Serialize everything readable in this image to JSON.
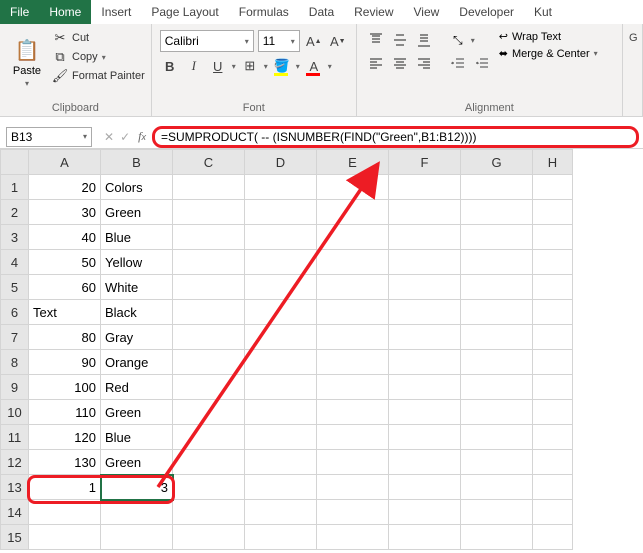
{
  "tabs": {
    "file": "File",
    "home": "Home",
    "insert": "Insert",
    "pageLayout": "Page Layout",
    "formulas": "Formulas",
    "data": "Data",
    "review": "Review",
    "view": "View",
    "developer": "Developer",
    "kutools": "Kut"
  },
  "ribbon": {
    "clipboard": {
      "paste": "Paste",
      "cut": "Cut",
      "copy": "Copy",
      "formatPainter": "Format Painter",
      "label": "Clipboard"
    },
    "font": {
      "name": "Calibri",
      "size": "11",
      "label": "Font"
    },
    "alignment": {
      "wrapText": "Wrap Text",
      "mergeCenter": "Merge & Center",
      "label": "Alignment"
    }
  },
  "nameBox": "B13",
  "formula": "=SUMPRODUCT( -- (ISNUMBER(FIND(\"Green\",B1:B12))))",
  "columns": [
    "A",
    "B",
    "C",
    "D",
    "E",
    "F",
    "G",
    "H"
  ],
  "rows": [
    {
      "n": "1",
      "a": "20",
      "b": "Colors"
    },
    {
      "n": "2",
      "a": "30",
      "b": "Green"
    },
    {
      "n": "3",
      "a": "40",
      "b": "Blue"
    },
    {
      "n": "4",
      "a": "50",
      "b": "Yellow"
    },
    {
      "n": "5",
      "a": "60",
      "b": "White"
    },
    {
      "n": "6",
      "a": "Text",
      "b": "Black",
      "atxt": true
    },
    {
      "n": "7",
      "a": "80",
      "b": "Gray"
    },
    {
      "n": "8",
      "a": "90",
      "b": "Orange"
    },
    {
      "n": "9",
      "a": "100",
      "b": "Red"
    },
    {
      "n": "10",
      "a": "110",
      "b": "Green"
    },
    {
      "n": "11",
      "a": "120",
      "b": "Blue"
    },
    {
      "n": "12",
      "a": "130",
      "b": "Green"
    },
    {
      "n": "13",
      "a": "1",
      "b": "3",
      "bnum": true,
      "sel": true
    },
    {
      "n": "14",
      "a": "",
      "b": ""
    },
    {
      "n": "15",
      "a": "",
      "b": ""
    }
  ]
}
